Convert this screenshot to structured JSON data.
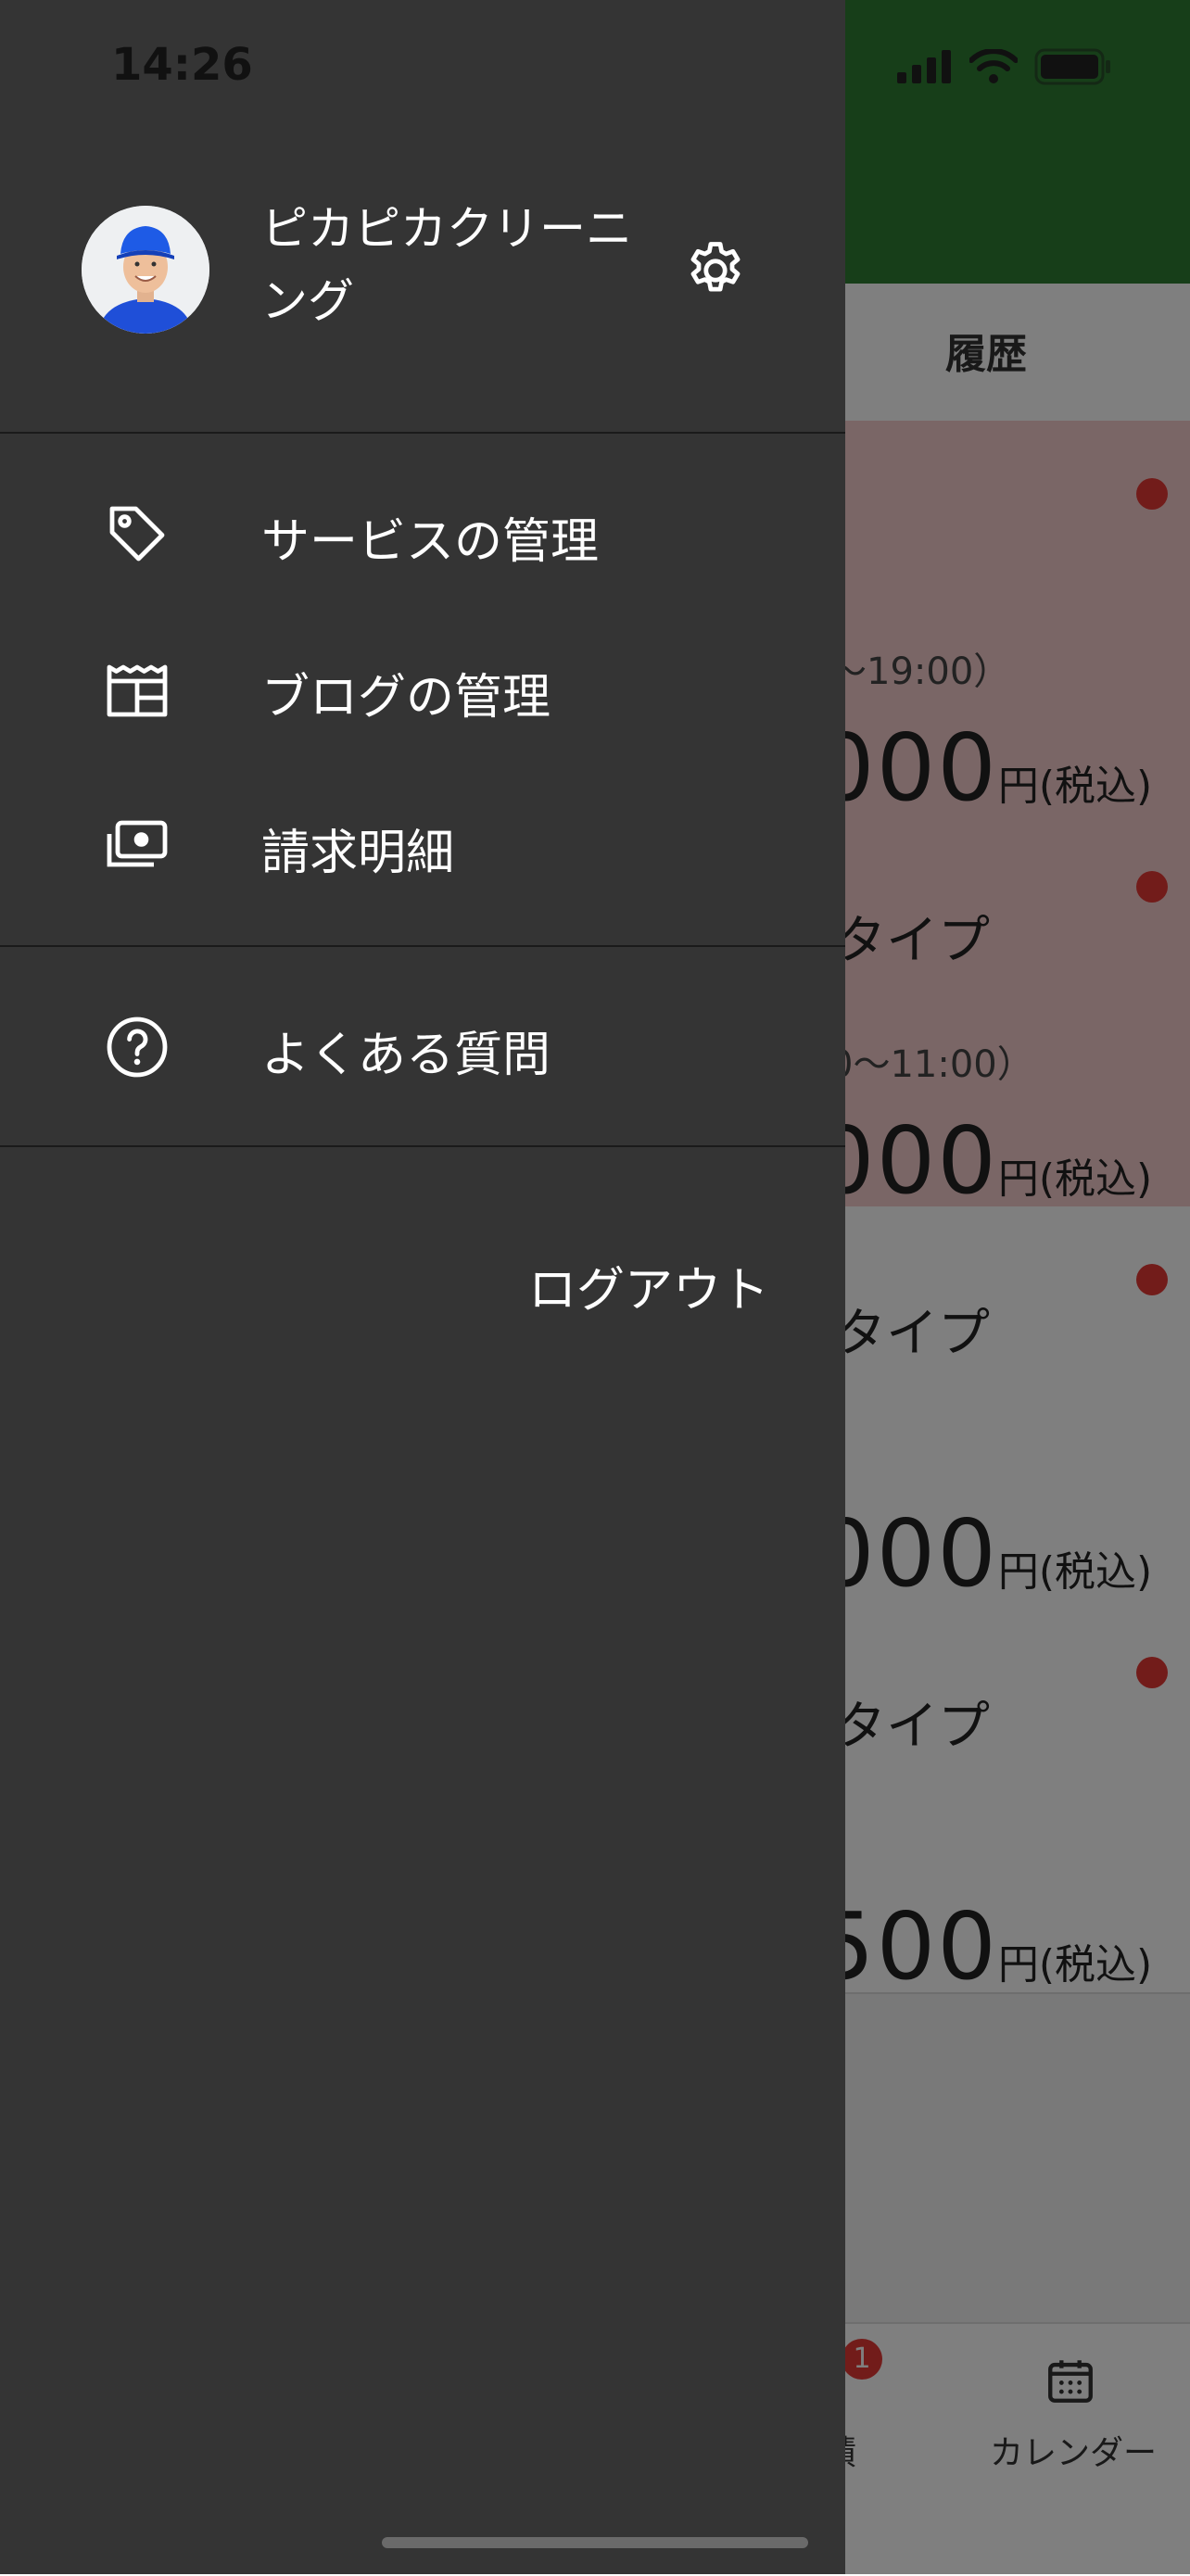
{
  "status_bar": {
    "time": "14:26"
  },
  "background": {
    "tab_history": "履歴",
    "cards": [
      {
        "title": "",
        "time": "〜19:00）",
        "price": "000",
        "unit": "円(税込)",
        "style": "pink"
      },
      {
        "title": "タイプ",
        "time": "0〜11:00）",
        "price": "000",
        "unit": "円(税込)",
        "style": "pink"
      },
      {
        "title": "タイプ",
        "time": "",
        "price": "000",
        "unit": "円(税込)",
        "style": "white"
      },
      {
        "title": "タイプ",
        "time": "",
        "price": "500",
        "unit": "円(税込)",
        "style": "white"
      }
    ],
    "bottom_nav": {
      "partial_label": "積",
      "badge": "1",
      "calendar_label": "カレンダー"
    },
    "colors": {
      "header": "#2e7d32",
      "card_pink": "#f4cccc",
      "dot": "#e53935"
    }
  },
  "drawer": {
    "profile": {
      "name": "ピカピカクリーニング",
      "settings_icon": "gear-icon"
    },
    "menu": [
      {
        "icon": "tag-icon",
        "label": "サービスの管理"
      },
      {
        "icon": "blog-icon",
        "label": "ブログの管理"
      },
      {
        "icon": "money-icon",
        "label": "請求明細"
      }
    ],
    "help": {
      "icon": "question-circle-icon",
      "label": "よくある質問"
    },
    "logout_label": "ログアウト",
    "colors": {
      "background": "#343434",
      "text": "#ffffff"
    }
  }
}
